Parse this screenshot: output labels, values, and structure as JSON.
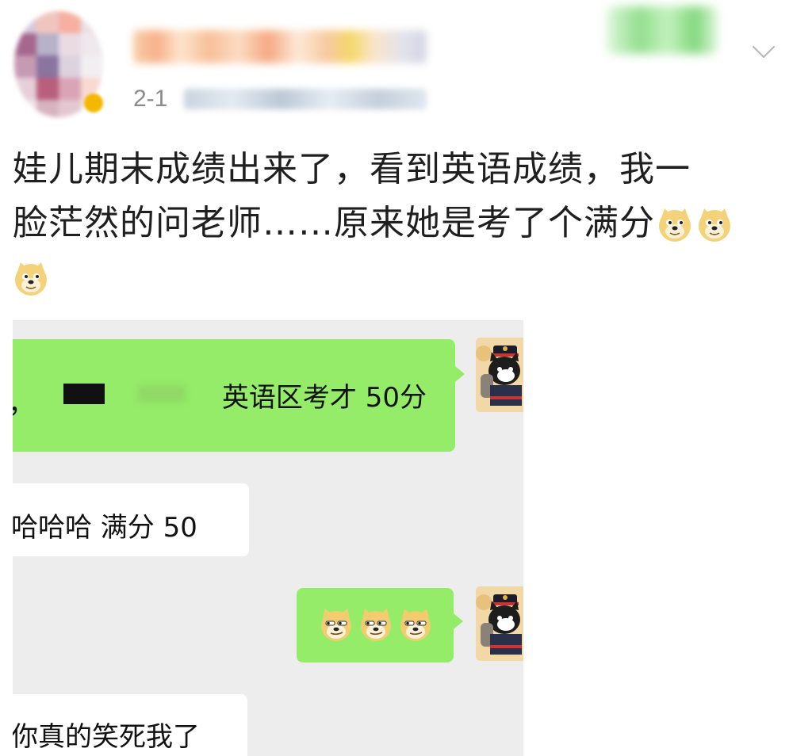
{
  "post": {
    "time": "2-1",
    "text_line1": "娃儿期末成绩出来了，看到英语成绩，我一",
    "text_line2": "脸茫然的问老师……原来她是考了个满分",
    "emojis": [
      "doge-emoji",
      "doge-emoji",
      "doge-emoji"
    ]
  },
  "header": {
    "menu_icon": "chevron-down-icon"
  },
  "chat": {
    "messages": [
      {
        "side": "right",
        "comma": "，",
        "text": "英语区考才 50分"
      },
      {
        "side": "left",
        "text": "哈哈哈   满分 50"
      },
      {
        "side": "right",
        "emojis": [
          "smirk-doge-emoji",
          "smirk-doge-emoji",
          "smirk-doge-emoji"
        ]
      },
      {
        "side": "left",
        "text": "你真的笑死我了"
      }
    ]
  },
  "colors": {
    "green_bubble": "#95ec69",
    "chat_bg": "#ededed",
    "time_gray": "#8a8a8a"
  }
}
